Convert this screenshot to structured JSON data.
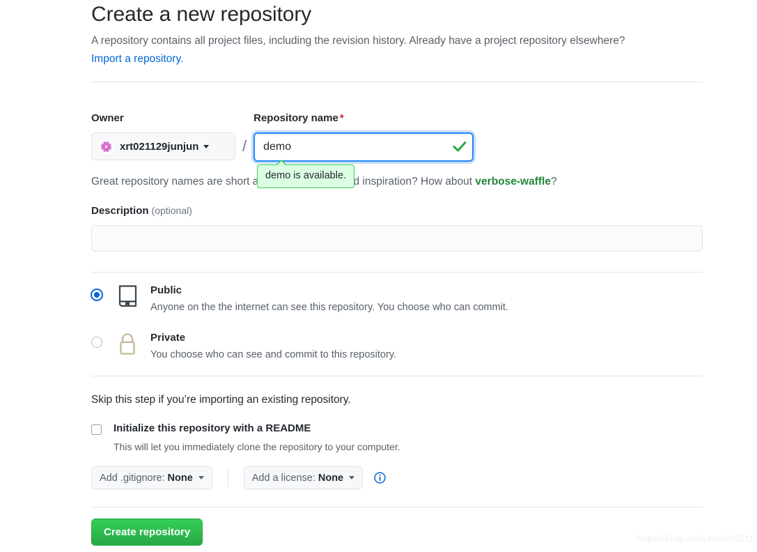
{
  "header": {
    "title": "Create a new repository",
    "description": "A repository contains all project files, including the revision history. Already have a project repository elsewhere?",
    "import_link": "Import a repository."
  },
  "owner": {
    "label": "Owner",
    "name": "xrt021129junjun",
    "avatar_icon": "identicon-avatar",
    "caret_icon": "chevron-down-icon"
  },
  "separator": "/",
  "repository_name": {
    "label": "Repository name",
    "required_marker": "*",
    "value": "demo",
    "placeholder": "",
    "valid_icon": "check-icon",
    "availability_tooltip": "demo is available."
  },
  "hint": {
    "text_before": "Great repository names are short and memorable.",
    "inspiration": "Need inspiration? How about",
    "suggestion": "verbose-waffle",
    "question_mark": "?"
  },
  "description_field": {
    "label": "Description",
    "optional": "(optional)",
    "value": "",
    "placeholder": ""
  },
  "visibility": {
    "options": [
      {
        "id": "public",
        "title": "Public",
        "subtitle": "Anyone on the the internet can see this repository. You choose who can commit.",
        "icon": "repo-book-icon",
        "selected": true
      },
      {
        "id": "private",
        "title": "Private",
        "subtitle": "You choose who can see and commit to this repository.",
        "icon": "lock-icon",
        "selected": false
      }
    ]
  },
  "initialize": {
    "lead": "Skip this step if you’re importing an existing repository.",
    "readme_label": "Initialize this repository with a README",
    "readme_sub": "This will let you immediately clone the repository to your computer.",
    "readme_checked": false,
    "gitignore_prefix": "Add .gitignore:",
    "gitignore_value": "None",
    "license_prefix": "Add a license:",
    "license_value": "None",
    "info_icon": "info-circle-icon"
  },
  "submit": {
    "label": "Create repository"
  },
  "watermark": "https://blog.csdn.net/xrt0211",
  "colors": {
    "link": "#0366d6",
    "focus_border": "#2188ff",
    "success_green": "#28a745",
    "suggestion_green": "#22863a",
    "tooltip_bg": "#dcffe4",
    "tooltip_border": "#34d058",
    "required_red": "#cb2431",
    "lock_tan": "#c4b998",
    "avatar_pink": "#d971cd",
    "muted_text": "#586069",
    "divider": "#e1e4e8"
  }
}
